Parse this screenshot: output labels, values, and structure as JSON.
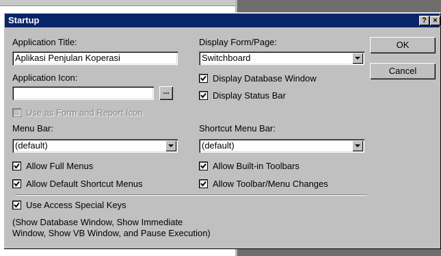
{
  "dialog": {
    "title": "Startup",
    "help_button": "?",
    "close_button": "×"
  },
  "app_title": {
    "label": "Application Title:",
    "value": "Aplikasi Penjulan Koperasi"
  },
  "app_icon": {
    "label": "Application Icon:",
    "value": "",
    "browse": "..."
  },
  "use_as_icon": {
    "label": "Use as Form and Report Icon",
    "checked": false,
    "disabled": true
  },
  "menu_bar": {
    "label": "Menu Bar:",
    "value": "(default)"
  },
  "allow_full_menus": {
    "label": "Allow Full Menus",
    "checked": true
  },
  "allow_default_shortcut": {
    "label": "Allow Default Shortcut Menus",
    "checked": true
  },
  "display_form": {
    "label": "Display Form/Page:",
    "value": "Switchboard"
  },
  "display_db_window": {
    "label": "Display Database Window",
    "checked": true
  },
  "display_status_bar": {
    "label": "Display Status Bar",
    "checked": true
  },
  "shortcut_menu_bar": {
    "label": "Shortcut Menu Bar:",
    "value": "(default)"
  },
  "allow_builtin_toolbars": {
    "label": "Allow Built-in Toolbars",
    "checked": true
  },
  "allow_toolbar_changes": {
    "label": "Allow Toolbar/Menu Changes",
    "checked": true
  },
  "use_special_keys": {
    "label": "Use Access Special Keys",
    "checked": true
  },
  "special_keys_note_line1": "(Show Database Window, Show Immediate",
  "special_keys_note_line2": "Window, Show VB Window, and Pause Execution)",
  "buttons": {
    "ok": "OK",
    "cancel": "Cancel"
  },
  "icons": {
    "check": "check-mark-icon",
    "dropdown": "chevron-down-icon"
  }
}
